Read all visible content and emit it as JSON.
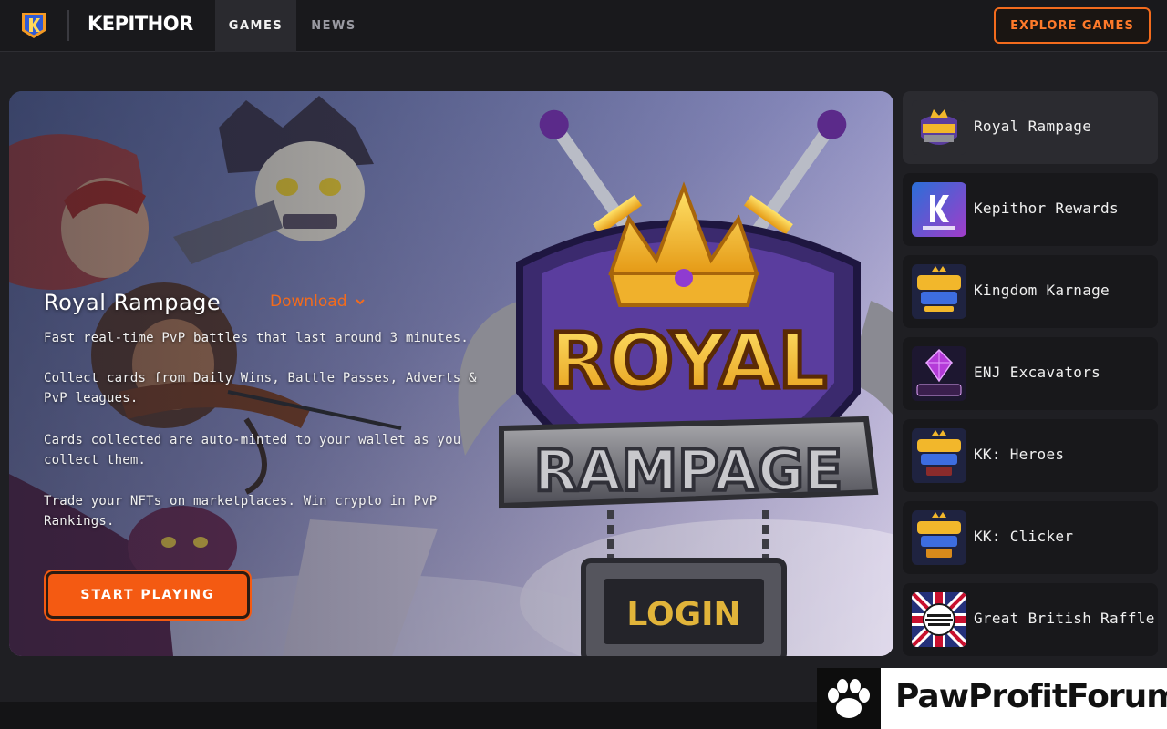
{
  "header": {
    "brand": "KEPITHOR",
    "tabs": [
      {
        "label": "GAMES",
        "active": true
      },
      {
        "label": "NEWS",
        "active": false
      }
    ],
    "cta_label": "EXPLORE GAMES",
    "accent_color": "#f26b1d"
  },
  "hero": {
    "title": "Royal Rampage",
    "download_label": "Download",
    "paragraphs": [
      "Fast real-time PvP battles that last around 3 minutes.",
      "Collect cards from Daily Wins, Battle Passes, Adverts & PvP leagues.",
      "Cards collected are auto-minted to your wallet as you collect them.",
      "Trade your NFTs on marketplaces. Win crypto in PvP Rankings."
    ],
    "start_label": "START PLAYING",
    "art": {
      "logo_line1": "ROYAL",
      "logo_line2": "RAMPAGE",
      "login_sign": "LOGIN"
    }
  },
  "games": [
    {
      "name": "Royal Rampage",
      "active": true,
      "thumb_icon": "royal-rampage-icon"
    },
    {
      "name": "Kepithor Rewards",
      "active": false,
      "thumb_icon": "kepithor-rewards-icon"
    },
    {
      "name": "Kingdom Karnage",
      "active": false,
      "thumb_icon": "kingdom-karnage-icon"
    },
    {
      "name": "ENJ Excavators",
      "active": false,
      "thumb_icon": "enj-excavators-icon"
    },
    {
      "name": "KK: Heroes",
      "active": false,
      "thumb_icon": "kk-heroes-icon"
    },
    {
      "name": "KK: Clicker",
      "active": false,
      "thumb_icon": "kk-clicker-icon"
    },
    {
      "name": "Great British Raffle",
      "active": false,
      "thumb_icon": "great-british-raffle-icon"
    }
  ],
  "watermark": {
    "text": "PawProfitForum"
  }
}
